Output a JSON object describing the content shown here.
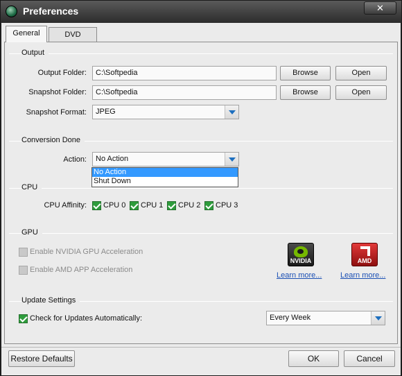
{
  "window": {
    "title": "Preferences",
    "close_label": "✕"
  },
  "tabs": [
    {
      "label": "General"
    },
    {
      "label": "DVD"
    }
  ],
  "output": {
    "group_label": "Output",
    "output_folder_label": "Output Folder:",
    "output_folder_value": "C:\\Softpedia",
    "snapshot_folder_label": "Snapshot Folder:",
    "snapshot_folder_value": "C:\\Softpedia",
    "browse_label": "Browse",
    "open_label": "Open",
    "snapshot_format_label": "Snapshot Format:",
    "snapshot_format_value": "JPEG"
  },
  "conversion": {
    "group_label": "Conversion Done",
    "action_label": "Action:",
    "action_value": "No Action",
    "options": [
      "No Action",
      "Shut Down"
    ]
  },
  "cpu": {
    "group_label": "CPU",
    "affinity_label": "CPU Affinity:",
    "cores": [
      "CPU 0",
      "CPU 1",
      "CPU 2",
      "CPU 3"
    ]
  },
  "gpu": {
    "group_label": "GPU",
    "nvidia_label": "Enable NVIDIA GPU Acceleration",
    "amd_label": "Enable AMD APP Acceleration",
    "nvidia_logo": "NVIDIA",
    "amd_logo": "AMD",
    "learn_more": "Learn more...",
    "colors": {
      "nvidia_green": "#76b900",
      "amd_red": "#d32020"
    }
  },
  "updates": {
    "group_label": "Update Settings",
    "check_label": "Check for Updates Automatically:",
    "frequency_value": "Every Week"
  },
  "footer": {
    "restore_label": "Restore Defaults",
    "ok_label": "OK",
    "cancel_label": "Cancel"
  }
}
